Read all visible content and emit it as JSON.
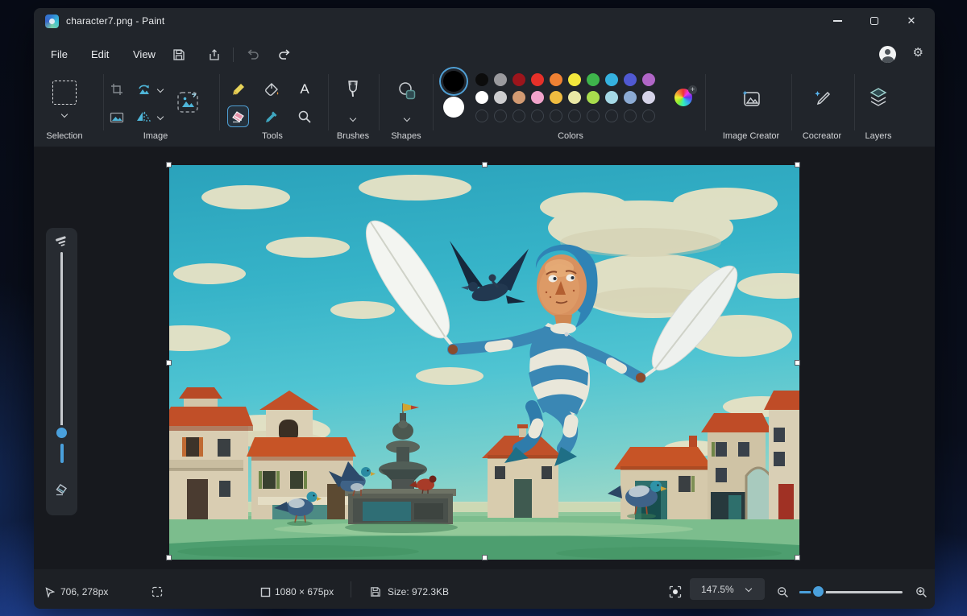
{
  "titlebar": {
    "title": "character7.png - Paint",
    "close_glyph": "✕"
  },
  "menubar": {
    "items": [
      "File",
      "Edit",
      "View"
    ]
  },
  "ribbon": {
    "groups": {
      "selection": "Selection",
      "image": "Image",
      "tools": "Tools",
      "brushes": "Brushes",
      "shapes": "Shapes",
      "colors": "Colors",
      "image_creator": "Image Creator",
      "cocreator": "Cocreator",
      "layers": "Layers"
    },
    "text_tool_glyph": "A"
  },
  "colors": {
    "foreground": "#000000",
    "background": "#ffffff",
    "accent": "#4f9fd4",
    "row1": [
      "#0c0c0c",
      "#9a9a9e",
      "#9c151c",
      "#e63029",
      "#ef8133",
      "#f2e73c",
      "#3eb54b",
      "#35b2e0",
      "#5059d2",
      "#b066c7"
    ],
    "row2": [
      "#ffffff",
      "#cdcdcf",
      "#d29a72",
      "#f2a3cb",
      "#f0bc40",
      "#eae8a5",
      "#a8dd4d",
      "#a5d9e6",
      "#8cabd4",
      "#d5d3e8"
    ],
    "empty_slots": 10,
    "edit_color_plus": "+"
  },
  "statusbar": {
    "cursor_position": "706, 278px",
    "image_dimensions": "1080 × 675px",
    "file_size": "Size: 972.3KB",
    "zoom_value": "147.5%"
  }
}
